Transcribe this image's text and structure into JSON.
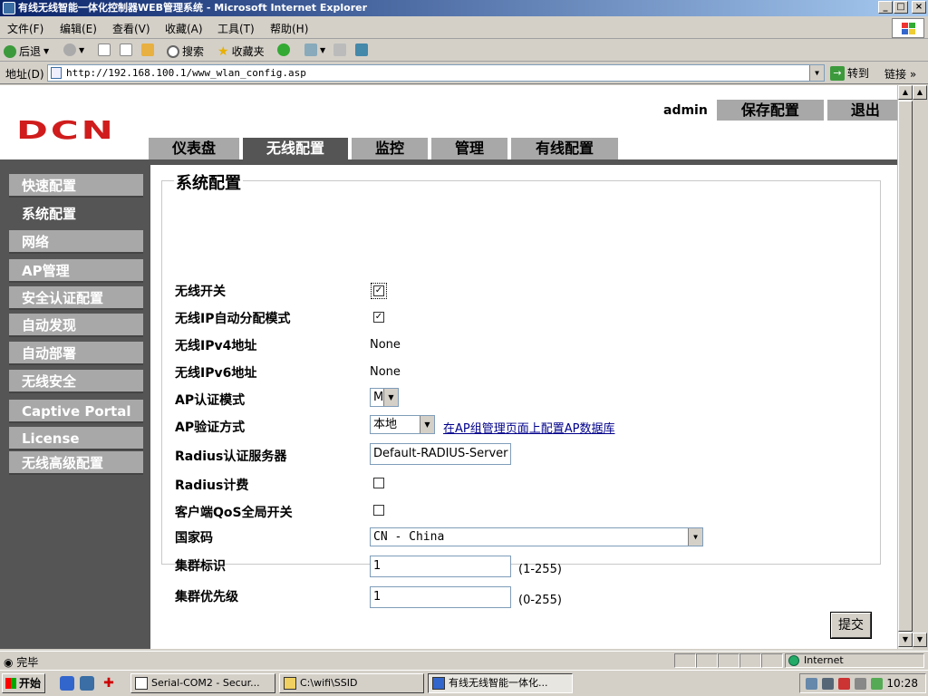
{
  "window": {
    "title": "有线无线智能一体化控制器WEB管理系统 - Microsoft Internet Explorer"
  },
  "menu": [
    "文件(F)",
    "编辑(E)",
    "查看(V)",
    "收藏(A)",
    "工具(T)",
    "帮助(H)"
  ],
  "toolbar": {
    "back": "后退",
    "search": "搜索",
    "favorites": "收藏夹"
  },
  "address": {
    "label": "地址(D)",
    "url": "http://192.168.100.1/www_wlan_config.asp",
    "go": "转到",
    "links": "链接"
  },
  "header": {
    "logo": "DCN",
    "user": "admin",
    "save": "保存配置",
    "logout": "退出"
  },
  "nav": [
    "仪表盘",
    "无线配置",
    "监控",
    "管理",
    "有线配置"
  ],
  "nav_active": "无线配置",
  "sidebar": [
    "快速配置",
    "系统配置",
    "网络",
    "AP管理",
    "安全认证配置",
    "自动发现",
    "自动部署",
    "无线安全",
    "Captive Portal",
    "License",
    "无线高级配置"
  ],
  "sidebar_active": "系统配置",
  "form": {
    "title": "系统配置",
    "wireless_switch": {
      "label": "无线开关",
      "checked": true
    },
    "ip_auto": {
      "label": "无线IP自动分配模式",
      "checked": true
    },
    "ipv4": {
      "label": "无线IPv4地址",
      "value": "None"
    },
    "ipv6": {
      "label": "无线IPv6地址",
      "value": "None"
    },
    "ap_auth_mode": {
      "label": "AP认证模式",
      "value": "M."
    },
    "ap_verify": {
      "label": "AP验证方式",
      "value": "本地",
      "link": "在AP组管理页面上配置AP数据库"
    },
    "radius_server": {
      "label": "Radius认证服务器",
      "value": "Default-RADIUS-Server"
    },
    "radius_billing": {
      "label": "Radius计费",
      "checked": false
    },
    "qos": {
      "label": "客户端QoS全局开关",
      "checked": false
    },
    "country": {
      "label": "国家码",
      "value": "CN - China"
    },
    "cluster_id": {
      "label": "集群标识",
      "value": "1",
      "hint": "(1-255)"
    },
    "cluster_priority": {
      "label": "集群优先级",
      "value": "1",
      "hint": "(0-255)"
    },
    "submit": "提交"
  },
  "status": {
    "text": "完毕",
    "zone": "Internet"
  },
  "taskbar": {
    "start": "开始",
    "tasks": [
      "Serial-COM2 - Secur...",
      "C:\\wifi\\SSID",
      "有线无线智能一体化..."
    ],
    "clock": "10:28"
  }
}
